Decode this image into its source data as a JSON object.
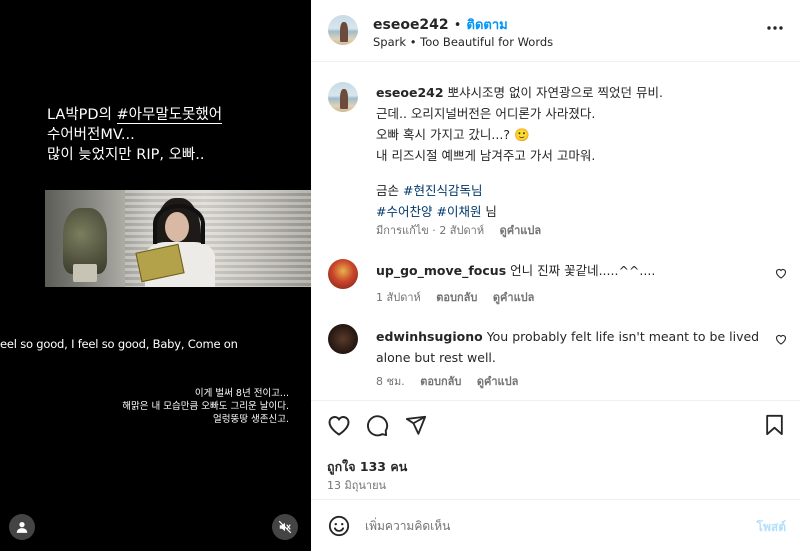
{
  "media": {
    "caption_line1_prefix": "LA박PD의 ",
    "caption_line1_hashtag": "#아무말도못했어",
    "caption_line2": "수어버전MV...",
    "caption_line3": "많이 늦었지만 RIP, 오빠..",
    "subtitle_english": "eel so good, I feel so good, Baby, Come on",
    "subtitle_korean": [
      "이게 벌써 8년 전이고...",
      "해맑은 내 모습만큼 오빠도 그리운 날이다.",
      "얼렁뚱땅 생존신고."
    ]
  },
  "header": {
    "username": "eseoe242",
    "separator": "•",
    "follow_label": "ติดตาม",
    "audio": "Spark • Too Beautiful for Words",
    "more_icon": "more-horizontal-icon"
  },
  "caption": {
    "username": "eseoe242",
    "line1": "뽀샤시조명 없이 자연광으로 찍었던 뮤비.",
    "line2": "근데.. 오리지널버전은 어디론가 사라졌다.",
    "line3": "오빠 혹시 가지고 갔니...? 🙂",
    "line4": "내 리즈시절 예쁘게 남겨주고 가서 고마워.",
    "line5_prefix": "금손 ",
    "line5_tag": "#현진식감독님",
    "line6_tag1": "#수어찬양",
    "line6_tag2": "#이채원",
    "line6_suffix": " 님",
    "edited": "มีการแก้ไข",
    "time": "2 สัปดาห์",
    "see_translation": "ดูคำแปล"
  },
  "comments": [
    {
      "username": "up_go_move_focus",
      "text": "언니 진짜 꽃같네.....^^....",
      "time": "1 สัปดาห์",
      "reply": "ตอบกลับ",
      "see_translation": "ดูคำแปล"
    },
    {
      "username": "edwinhsugiono",
      "text": "You probably felt life isn't meant to be lived alone but rest well.",
      "text_line1": "You probably felt life isn't meant to be lived",
      "text_line2": "alone but rest well.",
      "time": "8 ชม.",
      "reply": "ตอบกลับ",
      "see_translation": "ดูคำแปล"
    }
  ],
  "actions": {
    "likes": "ถูกใจ 133 คน",
    "date": "13 มิถุนายน"
  },
  "composer": {
    "placeholder": "เพิ่มความคิดเห็น",
    "post_label": "โพสต์"
  },
  "colors": {
    "link_blue": "#0095f6",
    "hashtag": "#00376b",
    "muted": "#737373",
    "post_disabled": "#b2dffc"
  }
}
